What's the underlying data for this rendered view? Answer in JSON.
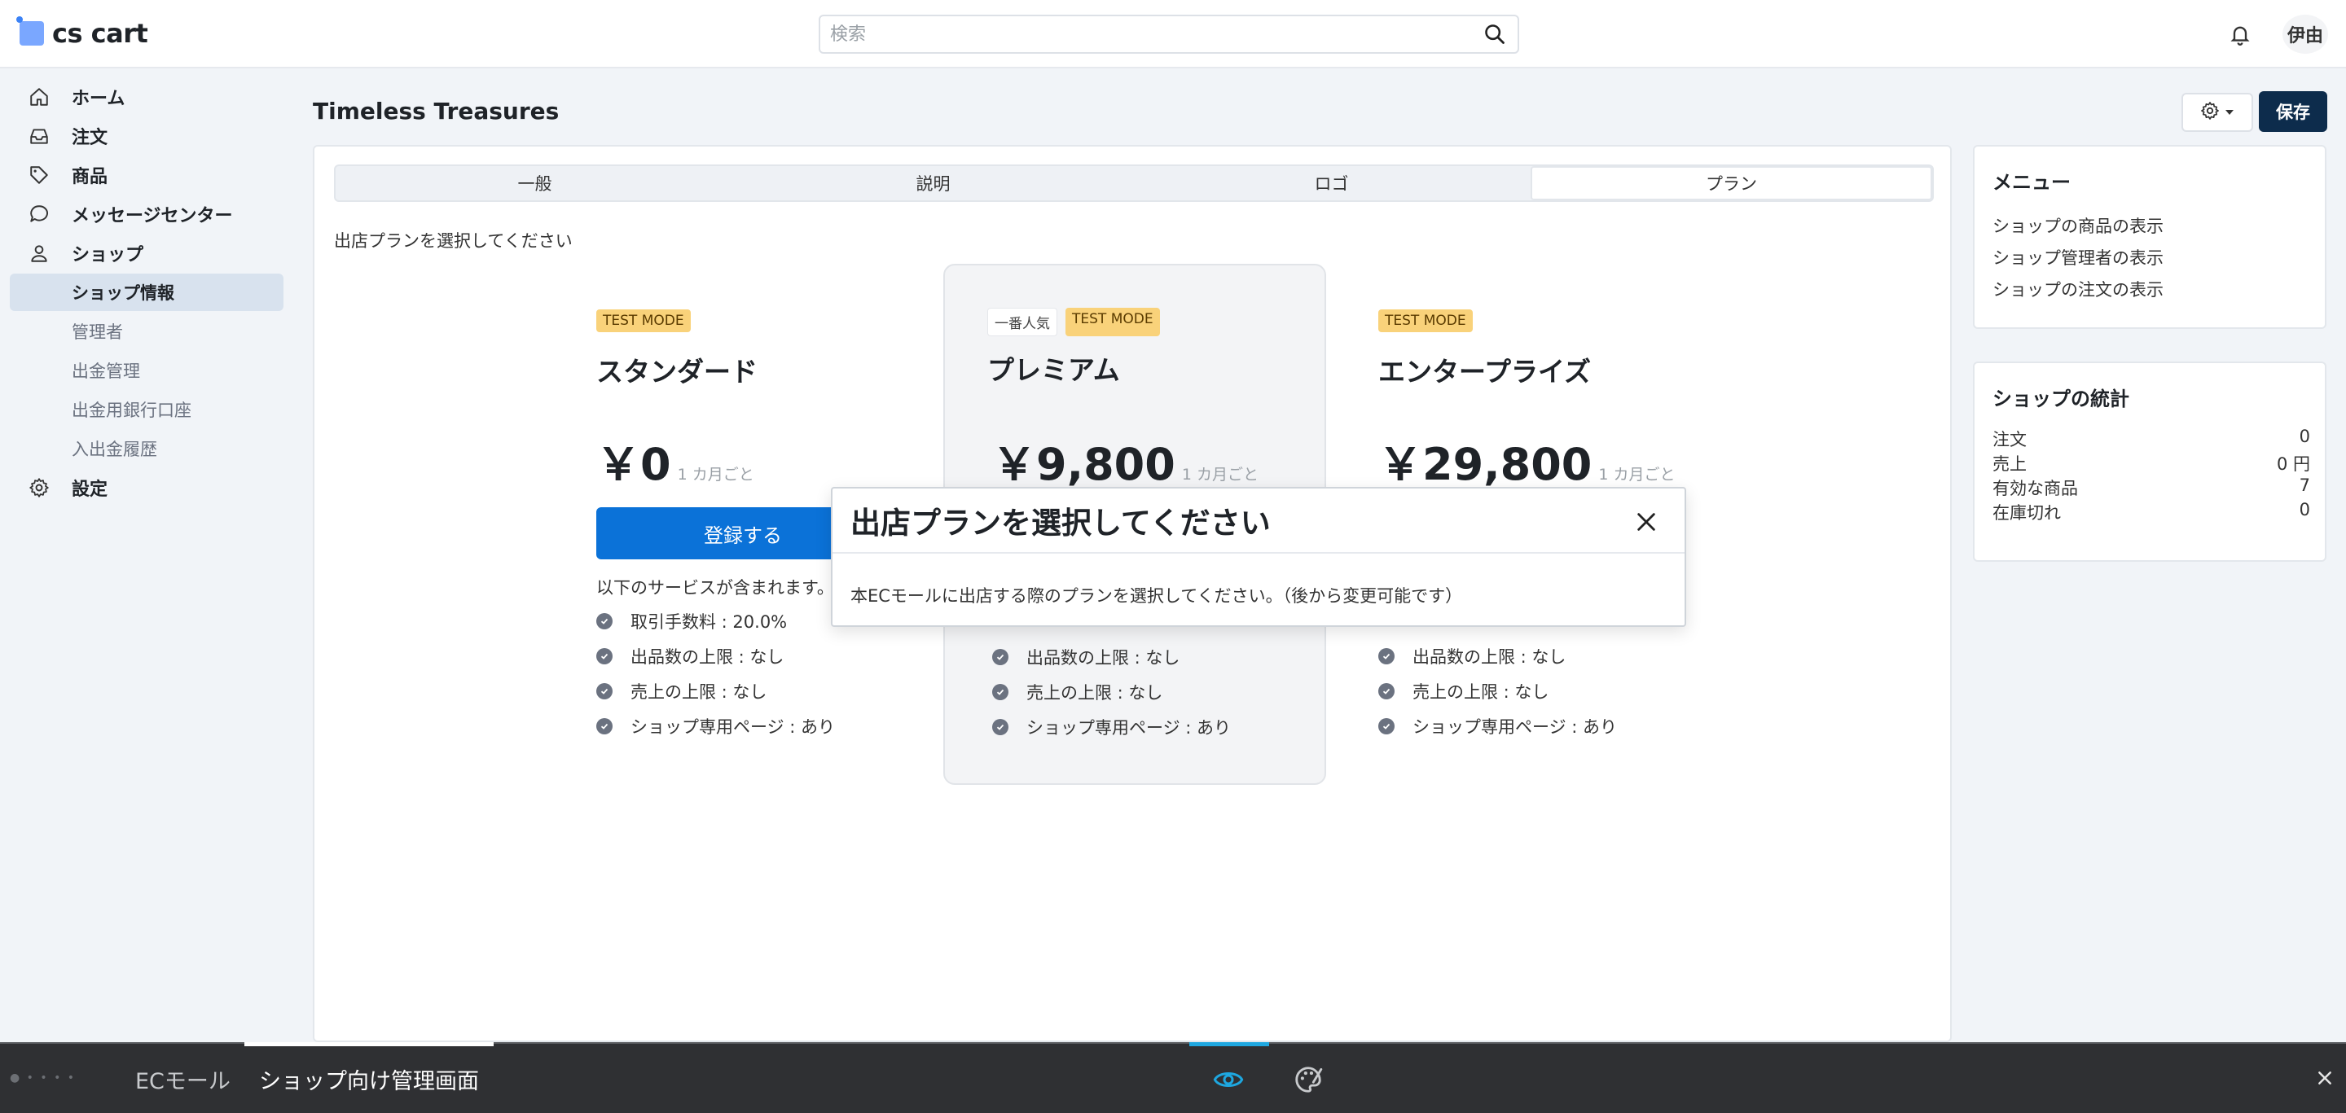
{
  "header": {
    "logo_text": "cs cart",
    "search_placeholder": "検索",
    "user_initials": "伊由"
  },
  "sidebar": {
    "items": [
      {
        "label": "ホーム",
        "icon": "home-icon"
      },
      {
        "label": "注文",
        "icon": "inbox-icon"
      },
      {
        "label": "商品",
        "icon": "tag-icon"
      },
      {
        "label": "メッセージセンター",
        "icon": "chat-icon"
      },
      {
        "label": "ショップ",
        "icon": "user-icon"
      },
      {
        "label": "設定",
        "icon": "gear-icon"
      }
    ],
    "sub_items": [
      {
        "label": "ショップ情報",
        "active": true
      },
      {
        "label": "管理者"
      },
      {
        "label": "出金管理"
      },
      {
        "label": "出金用銀行口座"
      },
      {
        "label": "入出金履歴"
      }
    ]
  },
  "page": {
    "title": "Timeless Treasures",
    "save_label": "保存"
  },
  "tabs": [
    "一般",
    "説明",
    "ロゴ",
    "プラン"
  ],
  "active_tab": "プラン",
  "plans_section": {
    "prompt": "出店プランを選択してください",
    "register_label": "登録する",
    "includes_label": "以下のサービスが含まれます。",
    "period": "1 カ月ごと",
    "test_mode_badge": "TEST MODE",
    "popular_badge": "一番人気",
    "plans": [
      {
        "name": "スタンダード",
        "price": "￥0",
        "features": [
          "取引手数料 : 20.0%",
          "出品数の上限 : なし",
          "売上の上限 : なし",
          "ショップ専用ページ : あり"
        ]
      },
      {
        "name": "プレミアム",
        "price": "￥9,800",
        "featured": true,
        "features": [
          "出品数の上限 : なし",
          "売上の上限 : なし",
          "ショップ専用ページ : あり"
        ]
      },
      {
        "name": "エンタープライズ",
        "price": "￥29,800",
        "features": [
          "出品数の上限 : なし",
          "売上の上限 : なし",
          "ショップ専用ページ : あり"
        ]
      }
    ]
  },
  "menu_card": {
    "title": "メニュー",
    "links": [
      "ショップの商品の表示",
      "ショップ管理者の表示",
      "ショップの注文の表示"
    ]
  },
  "stats_card": {
    "title": "ショップの統計",
    "rows": [
      {
        "label": "注文",
        "value": "0"
      },
      {
        "label": "売上",
        "value": "0 円"
      },
      {
        "label": "有効な商品",
        "value": "7"
      },
      {
        "label": "在庫切れ",
        "value": "0"
      }
    ]
  },
  "modal": {
    "title": "出店プランを選択してください",
    "body": "本ECモールに出店する際のプランを選択してください。（後から変更可能です）"
  },
  "bottom_bar": {
    "tabs": [
      "ECモール",
      "ショップ向け管理画面"
    ],
    "active_index": 1
  },
  "colors": {
    "primary": "#0b72d8",
    "save_button": "#0d2c4c",
    "badge": "#f9d27a",
    "active_sidebar": "#d8e2ee",
    "bottom_bar": "#2f3033",
    "eye_accent": "#1ea7e0"
  }
}
